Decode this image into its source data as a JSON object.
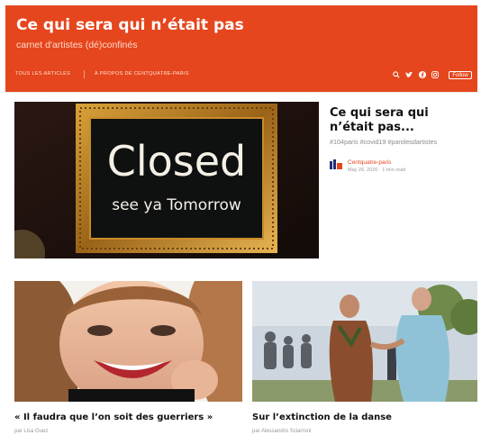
{
  "header": {
    "title": "Ce qui sera qui n’était pas",
    "subtitle": "carnet d'artistes (dé)confinés",
    "nav": [
      "TOUS LES ARTICLES",
      "À PROPOS DE CENTQUATRE-PARIS"
    ],
    "social_icons": [
      "search-icon",
      "twitter-icon",
      "facebook-icon",
      "instagram-icon"
    ],
    "follow_label": "Follow",
    "accent_color": "#e5461d"
  },
  "feature": {
    "image_text_line1": "Closed",
    "image_text_line2": "see ya Tomorrow",
    "title": "Ce qui sera qui n’était pas...",
    "tags": "#104paris #covid19 #parolesdartistes",
    "author": "Centquatre-paris",
    "meta": "May 26, 2020 · 1 min read"
  },
  "cards": [
    {
      "title": "« Il faudra que l’on soit des guerriers »",
      "author": "par Lisa Guez"
    },
    {
      "title": "Sur l’extinction de la danse",
      "author": "par Alessandro Sciarroni"
    }
  ]
}
